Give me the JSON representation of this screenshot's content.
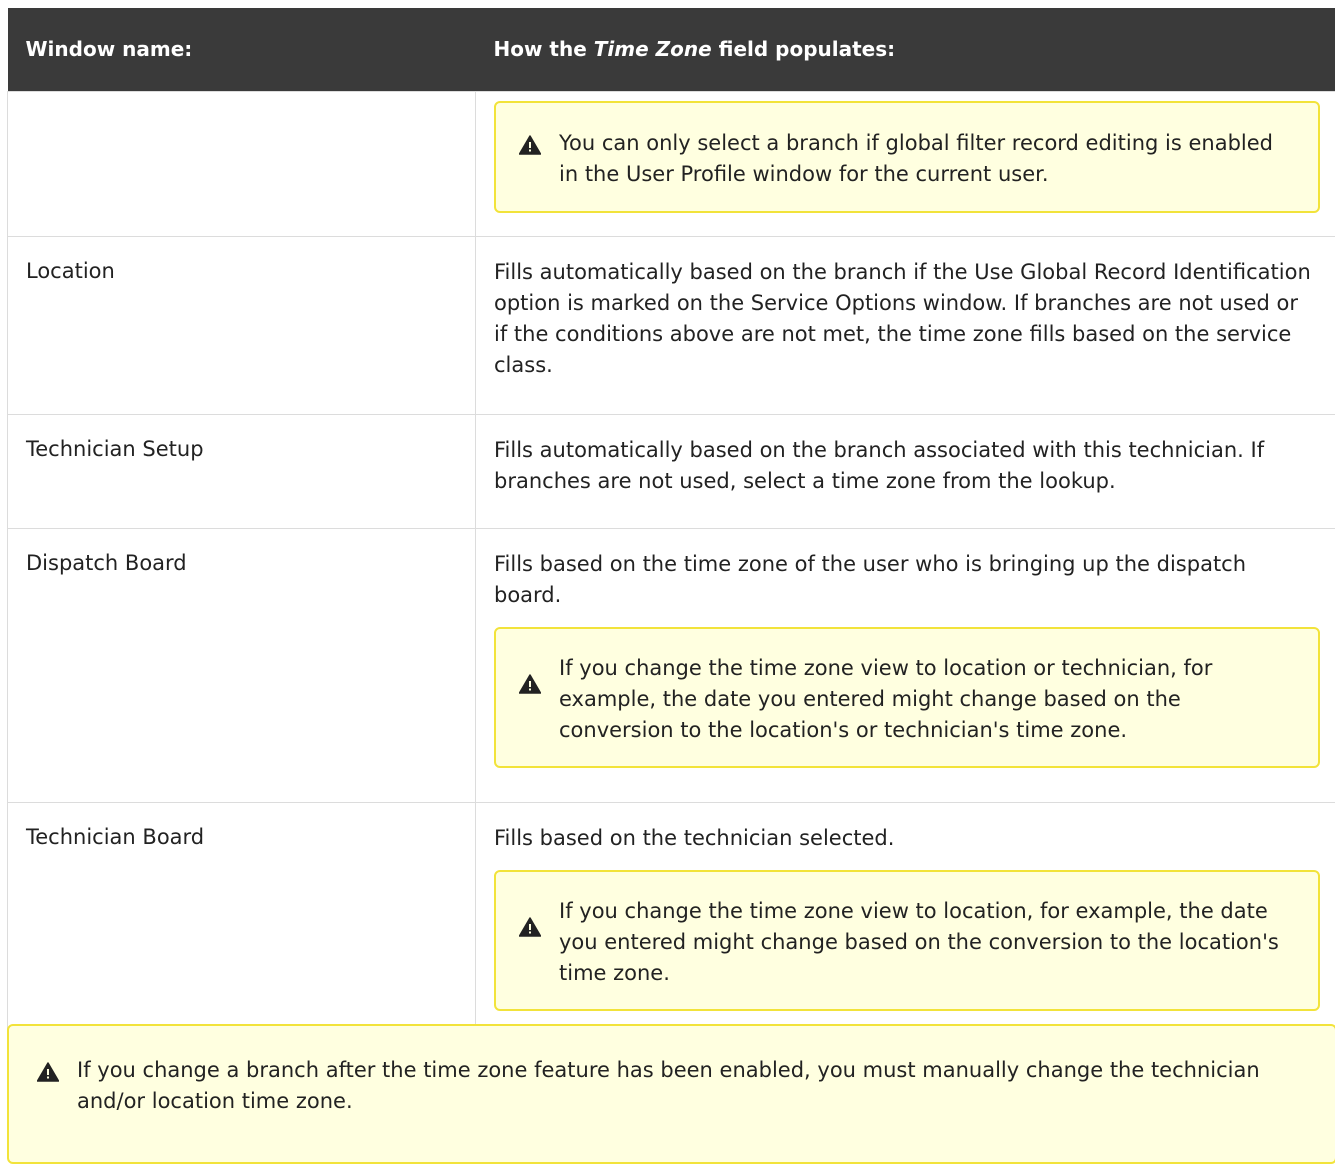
{
  "table": {
    "header": {
      "col1": "Window name:",
      "col2_prefix": "How the ",
      "col2_em": "Time Zone",
      "col2_suffix": " field populates:"
    },
    "rows": [
      {
        "name": "",
        "text": "",
        "note": "You can only select a branch if global filter record editing is enabled in the User Profile window for the current user."
      },
      {
        "name": "Location",
        "text": "Fills automatically based on the branch if the Use Global Record Identification option is marked on the Service Options window. If branches are not used or if the conditions above are not met, the time zone fills based on the service class."
      },
      {
        "name": "Technician Setup",
        "text": "Fills automatically based on the branch associated with this technician. If branches are not used, select a time zone from the lookup."
      },
      {
        "name": "Dispatch Board",
        "text": "Fills based on the time zone of the user who is bringing up the dispatch board.",
        "note": "If you change the time zone view to location or technician, for example, the date you entered might change based on the conversion to the location's or technician's time zone."
      },
      {
        "name": "Technician Board",
        "text": "Fills based on the technician selected.",
        "note": "If you change the time zone view to location, for example, the date you entered might change based on the conversion to the location's time zone."
      }
    ]
  },
  "bottom_note": {
    "text": "If you change a branch after the time zone feature has been enabled, you must manually change the technician and/or location time zone."
  },
  "colors": {
    "header_bg": "#3a3a3a",
    "note_bg": "#ffffe0",
    "note_border": "#f2e33a",
    "grid": "#dcdcdc"
  },
  "icons": {
    "warning": "warning-icon"
  }
}
